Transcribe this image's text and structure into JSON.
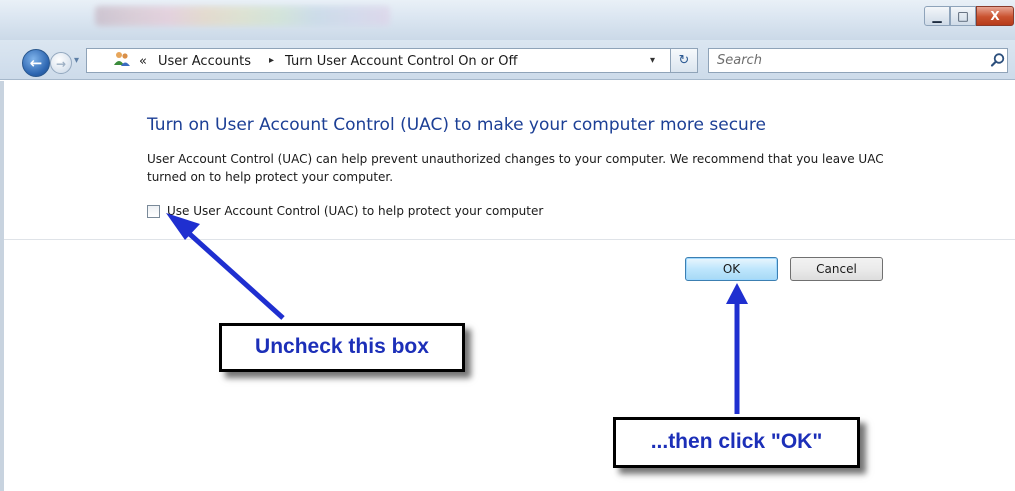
{
  "window": {
    "minimize_glyph": "▁",
    "maximize_glyph": "□",
    "close_glyph": "X",
    "close_color": "#c9522f"
  },
  "navigation": {
    "back_glyph": "←",
    "forward_glyph": "→",
    "recent_glyph": "▾",
    "breadcrumb_prefix": "«",
    "breadcrumb": [
      "User Accounts",
      "Turn User Account Control On or Off"
    ],
    "separator_glyph": "▸",
    "dropdown_glyph": "▾",
    "refresh_glyph": "↻",
    "search_placeholder": "Search"
  },
  "dialog": {
    "heading": "Turn on User Account Control (UAC) to make your computer more secure",
    "description": "User Account Control (UAC) can help prevent unauthorized changes to your computer.  We recommend that you leave UAC turned on to help protect your computer.",
    "checkbox_label": "Use User Account Control (UAC) to help protect your computer",
    "checkbox_checked": false,
    "ok_label": "OK",
    "cancel_label": "Cancel",
    "heading_color": "#1c3f95"
  },
  "annotations": {
    "callout_uncheck": "Uncheck this box",
    "callout_ok": "...then click \"OK\"",
    "text_color": "#1c2fb8",
    "arrow_color": "#1f2fd0"
  }
}
